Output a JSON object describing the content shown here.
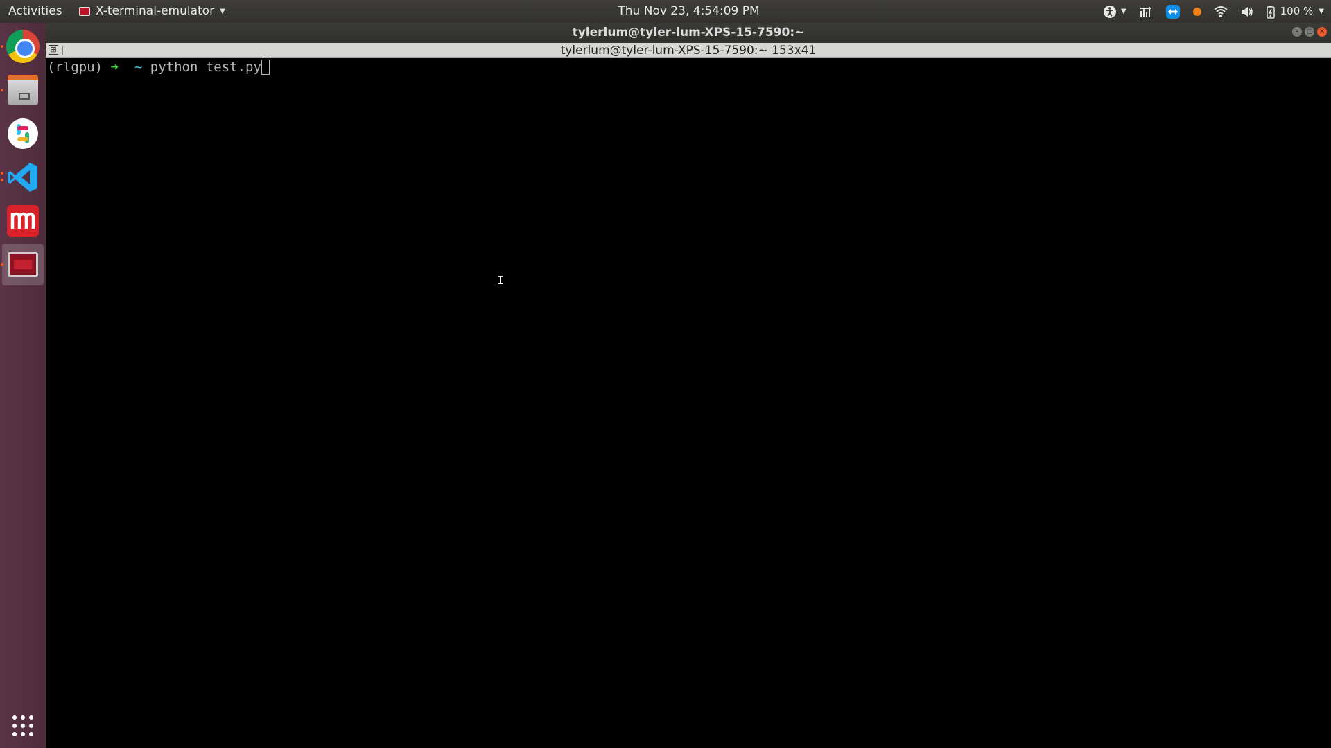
{
  "topbar": {
    "activities": "Activities",
    "app_name": "X-terminal-emulator",
    "clock": "Thu Nov 23,  4:54:09 PM",
    "battery": "100 %"
  },
  "dock": {
    "items": [
      {
        "name": "chrome",
        "icon": "chrome-icon",
        "running": true
      },
      {
        "name": "files",
        "icon": "files-icon",
        "running": true
      },
      {
        "name": "slack",
        "icon": "slack-icon",
        "running": false
      },
      {
        "name": "vscode",
        "icon": "vscode-icon",
        "running": true
      },
      {
        "name": "mendeley",
        "icon": "mendeley-icon",
        "running": false
      },
      {
        "name": "terminal",
        "icon": "terminal-icon",
        "running": true,
        "active": true
      }
    ],
    "apps_grid_icon": "show-apps-icon"
  },
  "window": {
    "title": "tylerlum@tyler-lum-XPS-15-7590:~",
    "tab_title": "tylerlum@tyler-lum-XPS-15-7590:~ 153x41"
  },
  "terminal": {
    "env": "(rlgpu)",
    "arrow": "➜",
    "cwd": "~",
    "command": "python test.py",
    "text_cursor": "I"
  },
  "colors": {
    "dock_bg": "#4e2c3b",
    "prompt_arrow": "#43d145",
    "prompt_cwd": "#3bc6d6",
    "close_button": "#e9592b"
  }
}
